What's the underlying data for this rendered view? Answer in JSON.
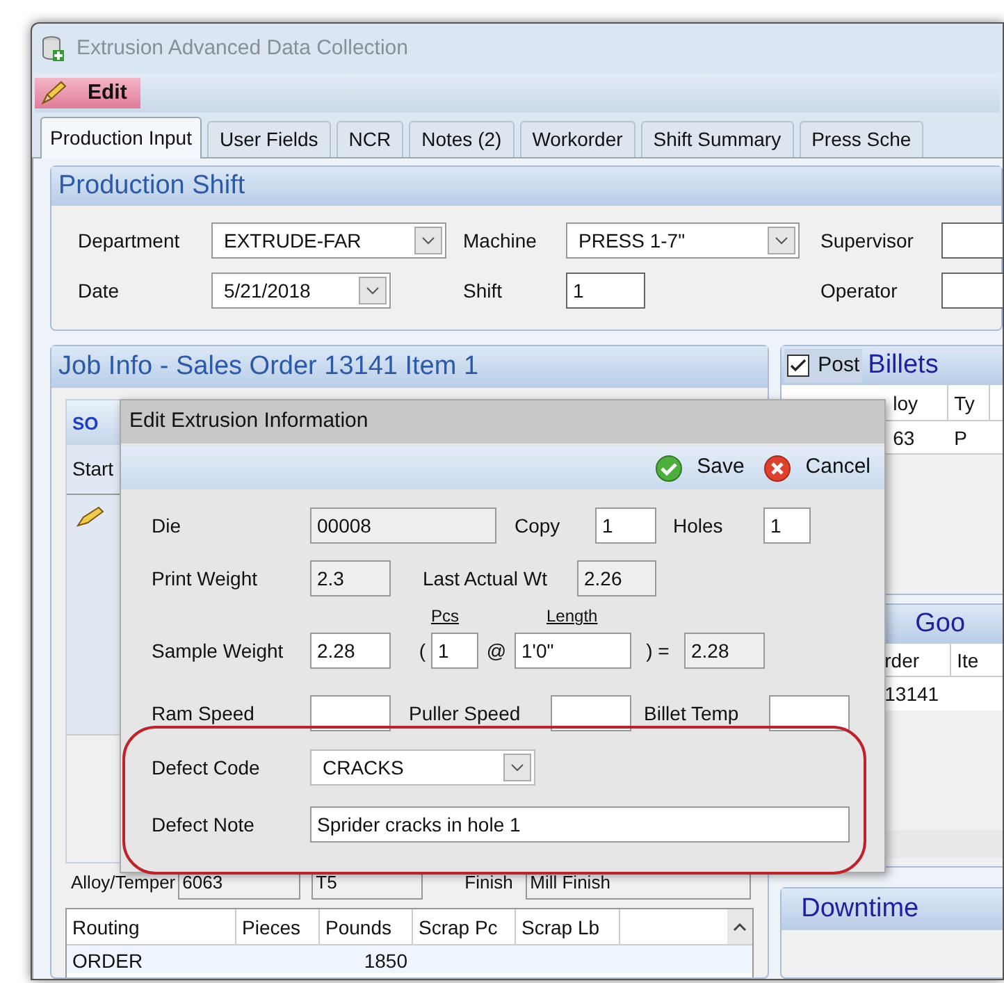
{
  "window": {
    "title": "Extrusion Advanced Data Collection"
  },
  "menu": {
    "label": "Edit"
  },
  "tabs": [
    {
      "label": "Production Input",
      "selected": true
    },
    {
      "label": "User Fields",
      "selected": false
    },
    {
      "label": "NCR",
      "selected": false
    },
    {
      "label": "Notes (2)",
      "selected": false
    },
    {
      "label": "Workorder",
      "selected": false
    },
    {
      "label": "Shift Summary",
      "selected": false
    },
    {
      "label": "Press Sche",
      "selected": false
    }
  ],
  "production_shift": {
    "title": "Production Shift",
    "fields": [
      {
        "label": "Department",
        "value": "EXTRUDE-FAR",
        "kind": "dropdown"
      },
      {
        "label": "Machine",
        "value": "PRESS 1-7\"",
        "kind": "dropdown"
      },
      {
        "label": "Supervisor",
        "kind": "text"
      },
      {
        "label": "Date",
        "value": "5/21/2018",
        "kind": "dropdown"
      },
      {
        "label": "Shift",
        "value": "1",
        "kind": "text"
      },
      {
        "label": "Operator",
        "kind": "text"
      }
    ]
  },
  "job_info": {
    "title": "Job Info - Sales Order 13141 Item 1",
    "toolbar_icon_text": "SO",
    "grid_column": "Start",
    "alloy_temper": {
      "label": "Alloy/Temper",
      "alloy": "6063",
      "temper": "T5"
    },
    "finish": {
      "label": "Finish",
      "value": "Mill Finish"
    },
    "routing_table": {
      "columns": [
        "Routing",
        "Pieces",
        "Pounds",
        "Scrap Pc",
        "Scrap Lb"
      ],
      "rows": [
        {
          "routing": "ORDER",
          "pounds": "1850"
        }
      ]
    }
  },
  "billets": {
    "post": {
      "label": "Post",
      "checked": true
    },
    "title": "Billets",
    "columns": [
      "loy",
      "Ty"
    ],
    "rows": [
      [
        "63",
        "P"
      ]
    ]
  },
  "goods": {
    "title": "Goo",
    "columns": [
      "rder",
      "Ite"
    ],
    "rows": [
      [
        "13141"
      ]
    ]
  },
  "downtime": {
    "title": "Downtime"
  },
  "dialog": {
    "title": "Edit Extrusion Information",
    "buttons": [
      {
        "label": "Save",
        "kind": "save"
      },
      {
        "label": "Cancel",
        "kind": "cancel"
      }
    ],
    "die": {
      "label": "Die",
      "value": "00008"
    },
    "copy": {
      "label": "Copy",
      "value": "1"
    },
    "holes": {
      "label": "Holes",
      "value": "1"
    },
    "print_weight": {
      "label": "Print Weight",
      "value": "2.3"
    },
    "last_actual_wt": {
      "label": "Last Actual Wt",
      "value": "2.26"
    },
    "sample_weight": {
      "label": "Sample Weight",
      "value": "2.28",
      "open_paren": "(",
      "pcs_label": "Pcs",
      "pcs": "1",
      "at": "@",
      "length_label": "Length",
      "length": "1'0\"",
      "equals": ") =",
      "result": "2.28"
    },
    "ram_speed": {
      "label": "Ram Speed"
    },
    "puller_speed": {
      "label": "Puller Speed"
    },
    "billet_temp": {
      "label": "Billet Temp"
    },
    "defect_code": {
      "label": "Defect Code",
      "value": "CRACKS"
    },
    "defect_note": {
      "label": "Defect Note",
      "value": "Sprider cracks in hole 1"
    }
  }
}
